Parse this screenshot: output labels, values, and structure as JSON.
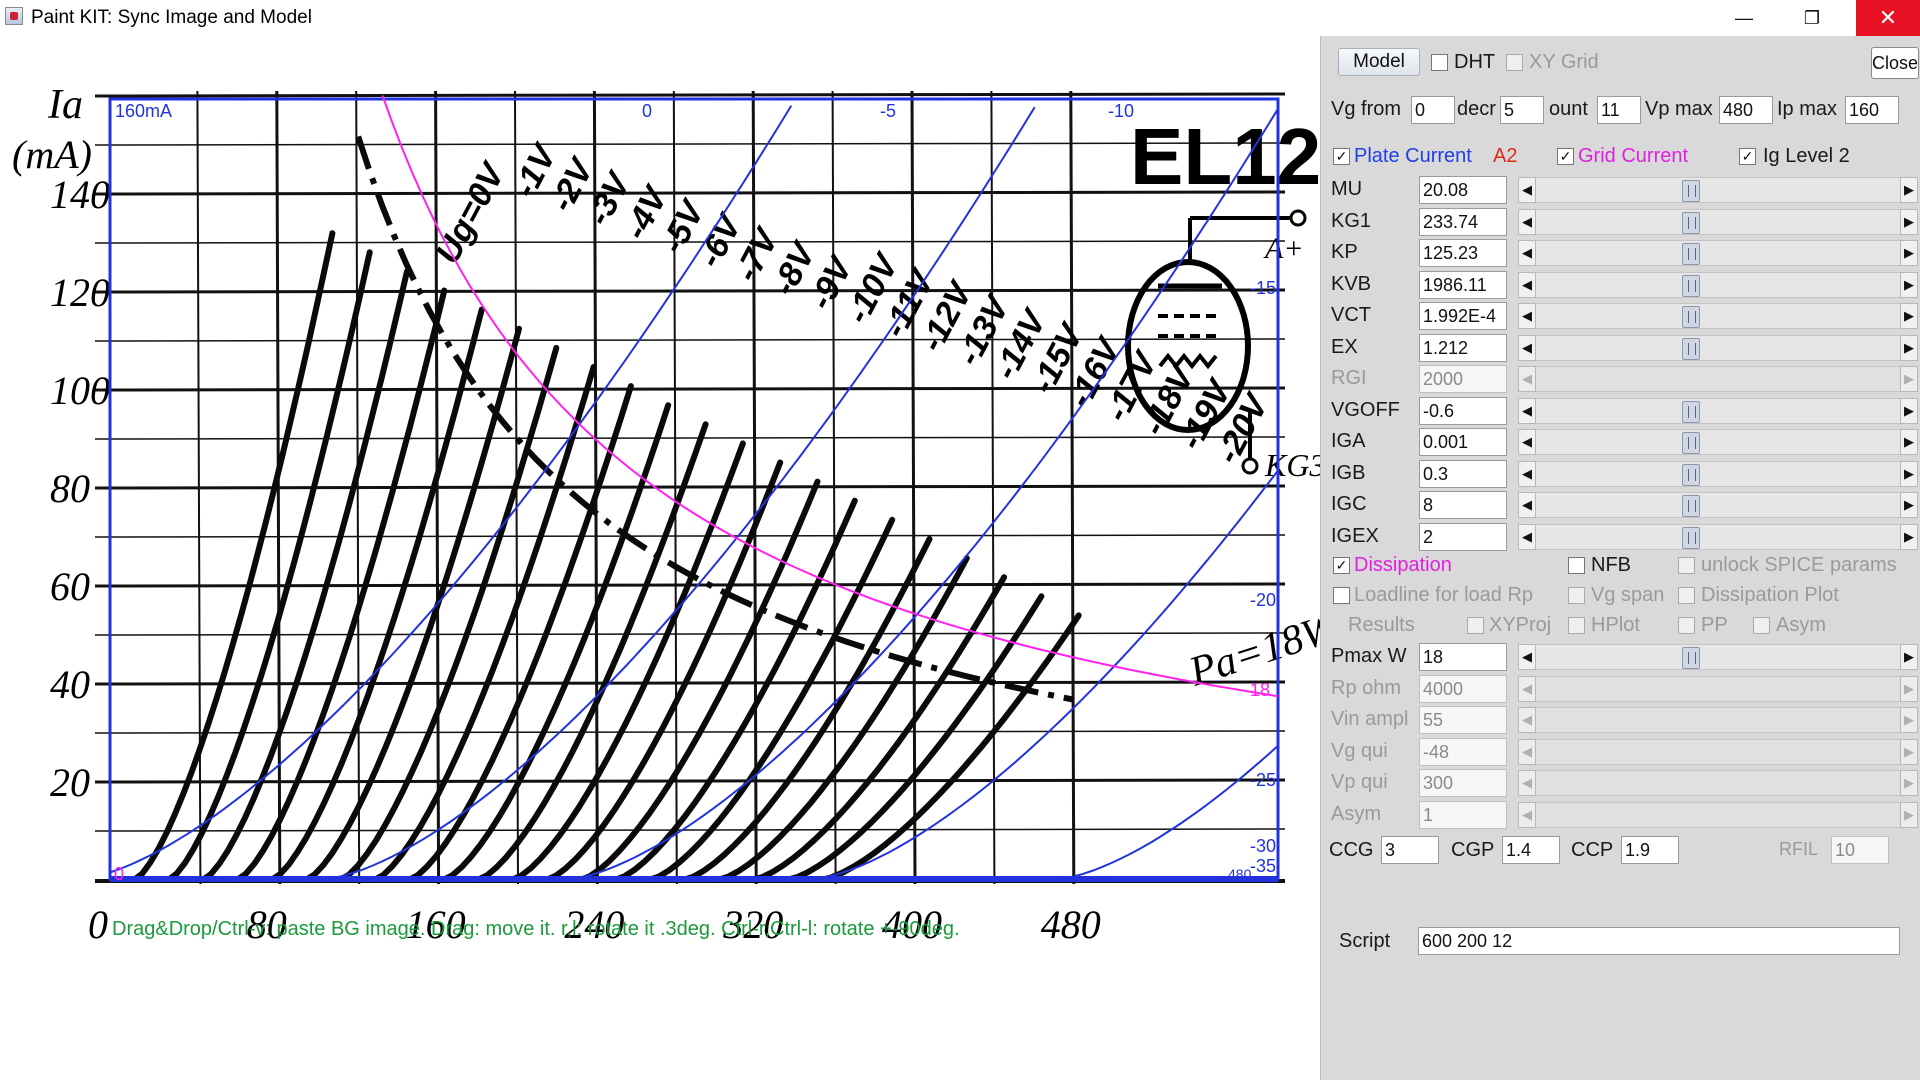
{
  "window": {
    "title": "Paint KIT: Sync Image and Model",
    "minimize_glyph": "—",
    "restore_glyph": "❐",
    "close_glyph": "✕"
  },
  "graph": {
    "bg_tube_name": "EL12",
    "bg_y_axis_label": "Ia",
    "bg_y_axis_unit": "(mA)",
    "bg_y_ticks": [
      "140",
      "120",
      "100",
      "80",
      "60",
      "40",
      "20"
    ],
    "bg_x_ticks": [
      "0",
      "80",
      "160",
      "240",
      "320",
      "400",
      "480"
    ],
    "bg_curve_labels": [
      "Ug=0V",
      "-1V",
      "-2V",
      "-3V",
      "-4V",
      "-5V",
      "-6V",
      "-7V",
      "-8V",
      "-9V",
      "-10V",
      "-11V",
      "-12V",
      "-13V",
      "-14V",
      "-15V",
      "-16V",
      "-17V",
      "-18V",
      "-19V",
      "-20V"
    ],
    "bg_pa_label": "Pa=18W",
    "bg_anode_label": "A+",
    "bg_kg_label": "KG3",
    "overlay_top_label": "160mA",
    "overlay_top_vg_labels": [
      "0",
      "-5",
      "-10"
    ],
    "overlay_right_vg_labels": [
      "-15",
      "-20",
      "-25",
      "-30",
      "-35"
    ],
    "overlay_pmax_label": "18",
    "overlay_bottom_right_label": "480",
    "overlay_origin_label": "0",
    "hint": "Drag&Drop/Ctrl-v: paste BG image. Drag: move it. r,l: rotate it .3deg. Ctrl-r,Ctrl-l: rotate +-90deg."
  },
  "colors": {
    "model_curves": "#2233dd",
    "dissipation_curve": "#ff22ee",
    "grid_current": "#e020e0",
    "plate_current": "#1f3fe0",
    "hint_text": "#1a9a3a",
    "close_button": "#e81123"
  },
  "panel": {
    "model_button": "Model",
    "close_button": "Close",
    "dht": {
      "label": "DHT",
      "checked": false
    },
    "xy_grid": {
      "label": "XY Grid",
      "checked": false
    },
    "vg_from": {
      "label": "Vg from",
      "value": "0"
    },
    "decr": {
      "label": "decr",
      "value": "5"
    },
    "count": {
      "label": "ount",
      "value": "11"
    },
    "vp_max": {
      "label": "Vp max",
      "value": "480"
    },
    "ip_max": {
      "label": "Ip max",
      "value": "160"
    },
    "plate_current": {
      "label": "Plate Current",
      "checked": true
    },
    "a2_label": "A2",
    "grid_current": {
      "label": "Grid Current",
      "checked": true
    },
    "ig_level2": {
      "label": "Ig Level 2",
      "checked": true
    },
    "check_glyph": "✓",
    "arrow_left": "◀",
    "arrow_right": "▶",
    "params": [
      {
        "label": "MU",
        "value": "20.08",
        "enabled": true
      },
      {
        "label": "KG1",
        "value": "233.74",
        "enabled": true
      },
      {
        "label": "KP",
        "value": "125.23",
        "enabled": true
      },
      {
        "label": "KVB",
        "value": "1986.11",
        "enabled": true
      },
      {
        "label": "VCT",
        "value": "1.992E-4",
        "enabled": true
      },
      {
        "label": "EX",
        "value": "1.212",
        "enabled": true
      },
      {
        "label": "RGI",
        "value": "2000",
        "enabled": false
      },
      {
        "label": "VGOFF",
        "value": "-0.6",
        "enabled": true
      },
      {
        "label": "IGA",
        "value": "0.001",
        "enabled": true
      },
      {
        "label": "IGB",
        "value": "0.3",
        "enabled": true
      },
      {
        "label": "IGC",
        "value": "8",
        "enabled": true
      },
      {
        "label": "IGEX",
        "value": "2",
        "enabled": true
      }
    ],
    "dissipation": {
      "label": "Dissipation",
      "checked": true
    },
    "nfb": {
      "label": "NFB",
      "checked": false
    },
    "unlock_spice": {
      "label": "unlock SPICE params",
      "checked": false
    },
    "loadline": {
      "label": "Loadline for load Rp",
      "checked": false
    },
    "vg_span": {
      "label": "Vg span",
      "checked": false
    },
    "dissipation_plot": {
      "label": "Dissipation Plot",
      "checked": false
    },
    "results_label": "Results",
    "xyproj": {
      "label": "XYProj",
      "checked": false
    },
    "hplot": {
      "label": "HPlot",
      "checked": false
    },
    "pp": {
      "label": "PP",
      "checked": false
    },
    "asym_check": {
      "label": "Asym",
      "checked": false
    },
    "params2": [
      {
        "label": "Pmax W",
        "value": "18",
        "enabled": true
      },
      {
        "label": "Rp ohm",
        "value": "4000",
        "enabled": false
      },
      {
        "label": "Vin ampl",
        "value": "55",
        "enabled": false
      },
      {
        "label": "Vg qui",
        "value": "-48",
        "enabled": false
      },
      {
        "label": "Vp qui",
        "value": "300",
        "enabled": false
      },
      {
        "label": "Asym",
        "value": "1",
        "enabled": false
      }
    ],
    "ccg": {
      "label": "CCG",
      "value": "3"
    },
    "cgp": {
      "label": "CGP",
      "value": "1.4"
    },
    "ccp": {
      "label": "CCP",
      "value": "1.9"
    },
    "rfil": {
      "label": "RFIL",
      "value": "10"
    },
    "script": {
      "label": "Script",
      "value": "600 200 12"
    }
  }
}
